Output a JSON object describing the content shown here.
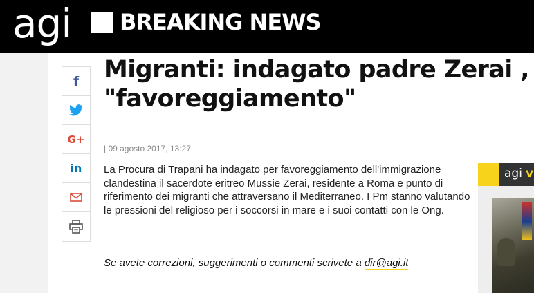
{
  "header": {
    "logo": "agi",
    "breaking_label": "BREAKING NEWS"
  },
  "share": {
    "facebook": "f",
    "twitter": "twitter-icon",
    "googleplus": "G+",
    "linkedin": "in",
    "email": "email-icon",
    "print": "print-icon"
  },
  "article": {
    "headline_line1": "Migranti: indagato padre  Zerai ,",
    "headline_line2": "\"favoreggiamento\"",
    "date": "| 09 agosto 2017, 13:27",
    "body": "La Procura di Trapani ha indagato per favoreggiamento dell'immigrazione clandestina il sacerdote eritreo Mussie Zerai, residente a Roma e punto di riferimento dei migranti che attraversano il Mediterraneo. I Pm stanno valutando le pressioni del religioso per i soccorsi in mare e i suoi contatti con le Ong.",
    "note_prefix": "Se avete correzioni, suggerimenti o commenti scrivete a ",
    "note_email": "dir@agi.it"
  },
  "sidebar": {
    "brand": "agi",
    "brand_suffix": "vi"
  },
  "colors": {
    "accent": "#f7d31b",
    "facebook": "#3b5998",
    "twitter": "#1da1f2",
    "googleplus": "#dd4b39",
    "linkedin": "#0077b5"
  }
}
